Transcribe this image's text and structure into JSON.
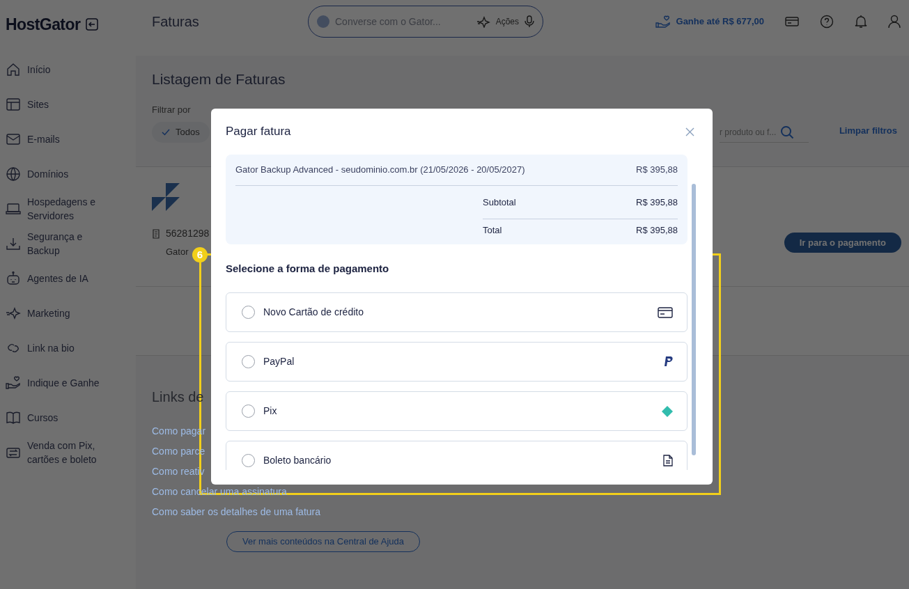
{
  "brand": {
    "logo": "HostGator"
  },
  "topbar": {
    "page_title": "Faturas",
    "assistant": {
      "placeholder": "Converse com o Gator...",
      "actions": "Ações"
    },
    "referral": "Ganhe até R$ 677,00"
  },
  "sidebar": {
    "items": [
      {
        "kind": "home",
        "label": "Início",
        "selected": false
      },
      {
        "kind": "sites",
        "label": "Sites",
        "selected": false
      },
      {
        "kind": "mail",
        "label": "E-mails",
        "selected": false
      },
      {
        "kind": "globe",
        "label": "Domínios",
        "selected": false
      },
      {
        "kind": "laptop",
        "label": "Hospedagens e Servidores",
        "selected": false
      },
      {
        "kind": "download",
        "label": "Segurança e Backup",
        "selected": false
      },
      {
        "kind": "robot",
        "label": "Agentes de IA",
        "selected": false
      },
      {
        "kind": "sparkle",
        "label": "Marketing",
        "selected": false
      },
      {
        "kind": "link",
        "label": "Link na bio",
        "selected": false
      },
      {
        "kind": "hand",
        "label": "Indique e Ganhe",
        "selected": false
      },
      {
        "kind": "book",
        "label": "Cursos",
        "selected": false
      },
      {
        "kind": "swap",
        "label": "Venda com Pix, cartões e boleto",
        "selected": false
      }
    ]
  },
  "content": {
    "heading": "Listagem de Faturas",
    "filter_label": "Filtrar por",
    "filter_chip": "Todos",
    "search": {
      "placeholder": "r produto ou f..."
    },
    "clear_filters": "Limpar filtros",
    "invoice": {
      "number": "56281298",
      "product": "Gator",
      "pay_button": "Ir para o pagamento"
    },
    "help": {
      "heading": "Links de",
      "links": [
        "Como pagar",
        "Como parce",
        "Como reativ",
        "Como cancelar uma assinatura",
        "Como saber os detalhes de uma fatura"
      ],
      "more_button": "Ver mais conteúdos na Central de Ajuda"
    }
  },
  "modal": {
    "title": "Pagar fatura",
    "summary": {
      "item": "Gator Backup Advanced - seudominio.com.br (21/05/2026 - 20/05/2027)",
      "item_price": "R$ 395,88",
      "subtotal_label": "Subtotal",
      "subtotal": "R$ 395,88",
      "total_label": "Total",
      "total": "R$ 395,88"
    },
    "payment_heading": "Selecione a forma de pagamento",
    "options": [
      {
        "kind": "card",
        "label": "Novo Cartão de crédito",
        "selected": false
      },
      {
        "kind": "paypal",
        "label": "PayPal",
        "selected": false
      },
      {
        "kind": "pix",
        "label": "Pix",
        "selected": false
      },
      {
        "kind": "boleto",
        "label": "Boleto bancário",
        "selected": false
      }
    ]
  },
  "annotation": {
    "number": "6"
  }
}
